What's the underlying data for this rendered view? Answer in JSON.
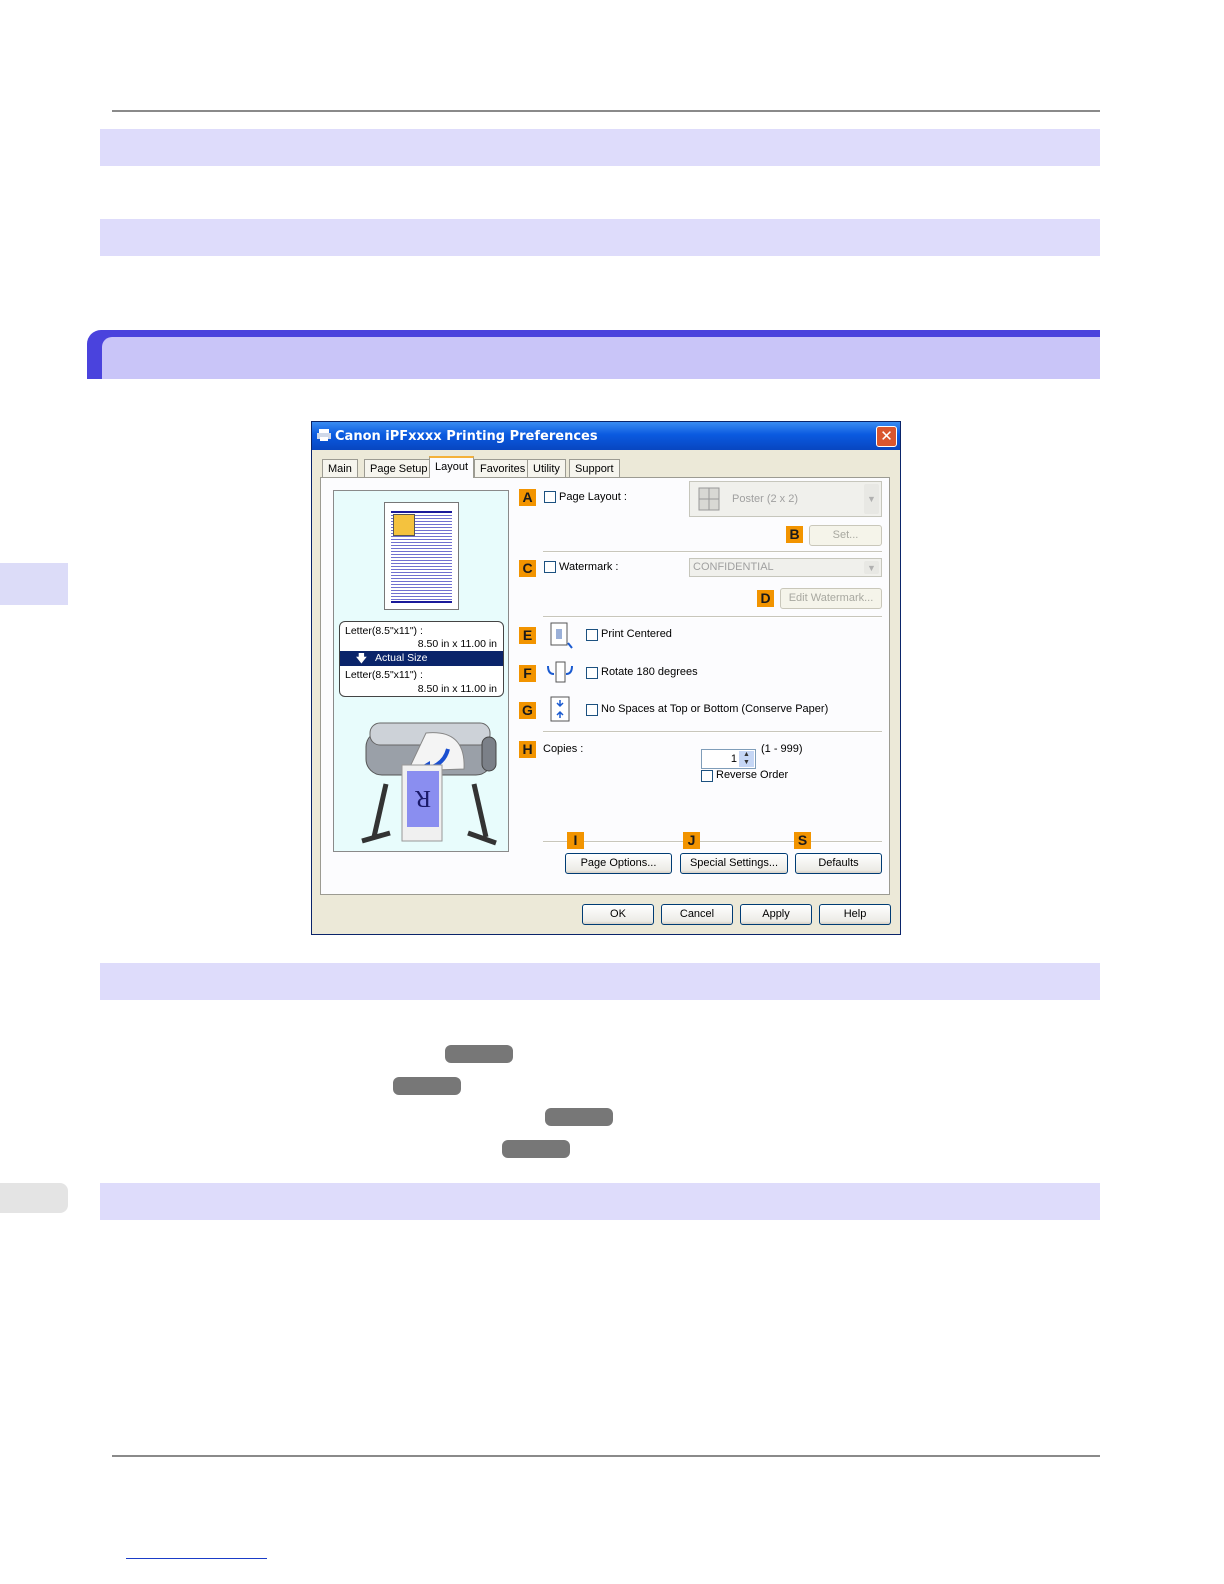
{
  "dialog": {
    "title": "Canon iPFxxxx Printing Preferences",
    "close_glyph": "✕",
    "tabs": [
      "Main",
      "Page Setup",
      "Layout",
      "Favorites",
      "Utility",
      "Support"
    ],
    "active_tab": "Layout",
    "preview": {
      "paper1_line1": "Letter(8.5\"x11\") :",
      "paper1_line2": "8.50 in x 11.00 in",
      "scaling": "Actual Size",
      "paper2_line1": "Letter(8.5\"x11\") :",
      "paper2_line2": "8.50 in x 11.00 in",
      "printer_glyph": "R"
    },
    "badges": {
      "A": "A",
      "B": "B",
      "C": "C",
      "D": "D",
      "E": "E",
      "F": "F",
      "G": "G",
      "H": "H",
      "I": "I",
      "J": "J",
      "S": "S"
    },
    "page_layout": {
      "label": "Page Layout :",
      "value": "Poster (2 x 2)",
      "set_button": "Set..."
    },
    "watermark": {
      "label": "Watermark :",
      "value": "CONFIDENTIAL",
      "edit_button": "Edit Watermark..."
    },
    "options": {
      "print_centered": "Print Centered",
      "rotate": "Rotate 180 degrees",
      "no_spaces": "No Spaces at Top or Bottom (Conserve Paper)"
    },
    "copies": {
      "label": "Copies :",
      "value": "1",
      "range": "(1 - 999)",
      "reverse_order": "Reverse Order"
    },
    "panel_buttons": {
      "page_options": "Page Options...",
      "special_settings": "Special Settings...",
      "defaults": "Defaults"
    },
    "footer_buttons": {
      "ok": "OK",
      "cancel": "Cancel",
      "apply": "Apply",
      "help": "Help"
    }
  },
  "colors": {
    "band": "#dedcfb",
    "heading_band": "#c9c5f8",
    "heading_accent": "#4a43dd",
    "badge": "#f29400",
    "pill": "#777777"
  }
}
